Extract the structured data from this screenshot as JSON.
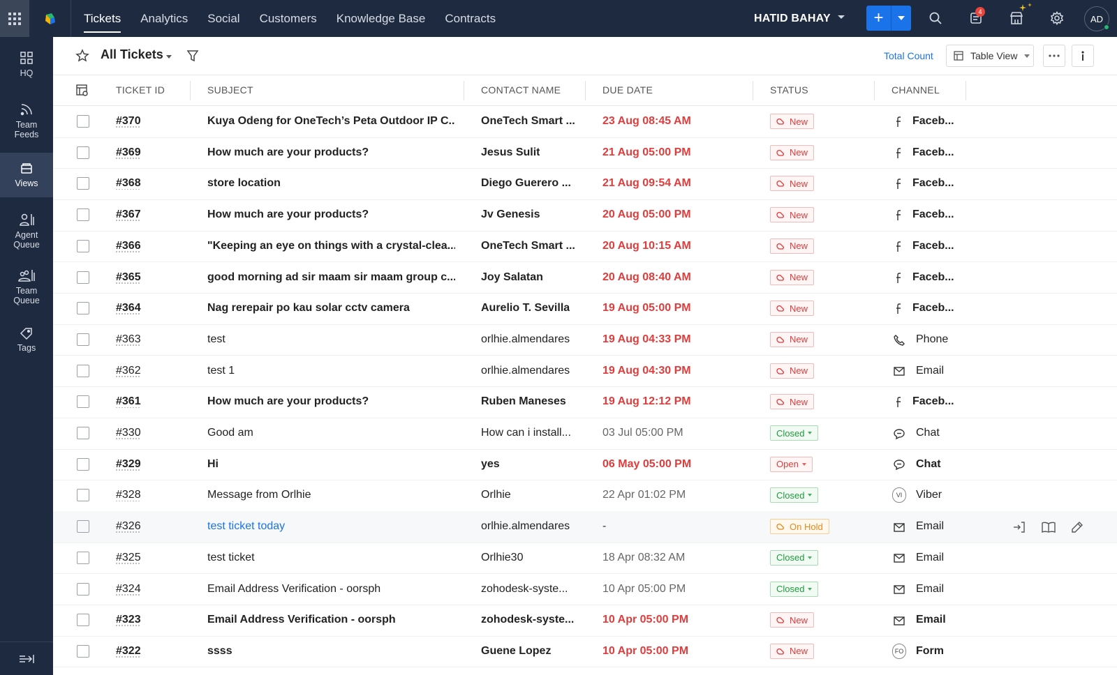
{
  "nav": {
    "tabs": [
      {
        "label": "Tickets",
        "active": true
      },
      {
        "label": "Analytics"
      },
      {
        "label": "Social"
      },
      {
        "label": "Customers"
      },
      {
        "label": "Knowledge Base"
      },
      {
        "label": "Contracts"
      }
    ],
    "user_name": "HATID BAHAY",
    "notification_count": "4",
    "avatar_initials": "AD"
  },
  "sidebar": {
    "items": [
      {
        "label": "HQ",
        "icon": "grid-icon"
      },
      {
        "label": "Team Feeds",
        "icon": "feed-icon"
      },
      {
        "label": "Views",
        "icon": "views-icon",
        "active": true
      },
      {
        "label": "Agent Queue",
        "icon": "agent-queue-icon"
      },
      {
        "label": "Team Queue",
        "icon": "team-queue-icon"
      },
      {
        "label": "Tags",
        "icon": "tag-icon"
      }
    ]
  },
  "toolbar": {
    "view_title": "All Tickets",
    "total_count_label": "Total Count",
    "table_view_label": "Table View"
  },
  "table": {
    "headers": [
      "TICKET ID",
      "SUBJECT",
      "CONTACT NAME",
      "DUE DATE",
      "STATUS",
      "CHANNEL"
    ],
    "rows": [
      {
        "id": "#370",
        "subject": "Kuya Odeng for OneTech’s Peta Outdoor IP C...",
        "contact": "OneTech Smart ...",
        "due": "23 Aug 08:45 AM",
        "status": "New",
        "channel": "Faceb...",
        "unread": true,
        "overdue": true
      },
      {
        "id": "#369",
        "subject": "How much are your products?",
        "contact": "Jesus Sulit",
        "due": "21 Aug 05:00 PM",
        "status": "New",
        "channel": "Faceb...",
        "unread": true,
        "overdue": true
      },
      {
        "id": "#368",
        "subject": "store location",
        "contact": "Diego Guerero ...",
        "due": "21 Aug 09:54 AM",
        "status": "New",
        "channel": "Faceb...",
        "unread": true,
        "overdue": true
      },
      {
        "id": "#367",
        "subject": "How much are your products?",
        "contact": "Jv Genesis",
        "due": "20 Aug 05:00 PM",
        "status": "New",
        "channel": "Faceb...",
        "unread": true,
        "overdue": true
      },
      {
        "id": "#366",
        "subject": "\"Keeping an eye on things with a crystal-clea...",
        "contact": "OneTech Smart ...",
        "due": "20 Aug 10:15 AM",
        "status": "New",
        "channel": "Faceb...",
        "unread": true,
        "overdue": true
      },
      {
        "id": "#365",
        "subject": "good morning ad sir maam sir maam group c...",
        "contact": "Joy Salatan",
        "due": "20 Aug 08:40 AM",
        "status": "New",
        "channel": "Faceb...",
        "unread": true,
        "overdue": true
      },
      {
        "id": "#364",
        "subject": "Nag rerepair po kau solar cctv camera",
        "contact": "Aurelio T. Sevilla",
        "due": "19 Aug 05:00 PM",
        "status": "New",
        "channel": "Faceb...",
        "unread": true,
        "overdue": true
      },
      {
        "id": "#363",
        "subject": "test",
        "contact": "orlhie.almendares",
        "due": "19 Aug 04:33 PM",
        "status": "New",
        "channel": "Phone",
        "unread": false,
        "overdue": true
      },
      {
        "id": "#362",
        "subject": "test 1",
        "contact": "orlhie.almendares",
        "due": "19 Aug 04:30 PM",
        "status": "New",
        "channel": "Email",
        "unread": false,
        "overdue": true
      },
      {
        "id": "#361",
        "subject": "How much are your products?",
        "contact": "Ruben Maneses",
        "due": "19 Aug 12:12 PM",
        "status": "New",
        "channel": "Faceb...",
        "unread": true,
        "overdue": true
      },
      {
        "id": "#330",
        "subject": "Good am",
        "contact": "How can i install...",
        "due": "03 Jul 05:00 PM",
        "status": "Closed",
        "channel": "Chat",
        "unread": false,
        "overdue": false
      },
      {
        "id": "#329",
        "subject": "Hi",
        "contact": "yes",
        "due": "06 May 05:00 PM",
        "status": "Open",
        "channel": "Chat",
        "unread": true,
        "overdue": true
      },
      {
        "id": "#328",
        "subject": "Message from Orlhie",
        "contact": "Orlhie",
        "due": "22 Apr 01:02 PM",
        "status": "Closed",
        "channel": "Viber",
        "unread": false,
        "overdue": false
      },
      {
        "id": "#326",
        "subject": "test ticket today",
        "contact": "orlhie.almendares",
        "due": "-",
        "status": "On Hold",
        "channel": "Email",
        "unread": false,
        "overdue": false,
        "hovered": true
      },
      {
        "id": "#325",
        "subject": "test ticket",
        "contact": "Orlhie30",
        "due": "18 Apr 08:32 AM",
        "status": "Closed",
        "channel": "Email",
        "unread": false,
        "overdue": false
      },
      {
        "id": "#324",
        "subject": "Email Address Verification - oorsph",
        "contact": "zohodesk-syste...",
        "due": "10 Apr 05:00 PM",
        "status": "Closed",
        "channel": "Email",
        "unread": false,
        "overdue": false
      },
      {
        "id": "#323",
        "subject": "Email Address Verification - oorsph",
        "contact": "zohodesk-syste...",
        "due": "10 Apr 05:00 PM",
        "status": "New",
        "channel": "Email",
        "unread": true,
        "overdue": true
      },
      {
        "id": "#322",
        "subject": "ssss",
        "contact": "Guene Lopez",
        "due": "10 Apr 05:00 PM",
        "status": "New",
        "channel": "Form",
        "unread": true,
        "overdue": true
      }
    ]
  },
  "channel_badges": {
    "Viber": "VI",
    "Form": "FO"
  },
  "colors": {
    "topbar": "#1d2a3f",
    "accent": "#1a73e8",
    "overdue": "#e03c3c",
    "closed": "#1e9b3c",
    "on_hold": "#e48a1a"
  }
}
